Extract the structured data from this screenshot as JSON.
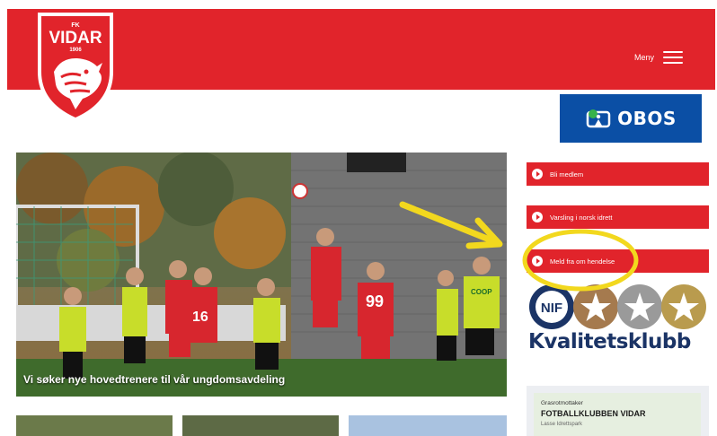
{
  "header": {
    "logo_text": "VIDAR",
    "logo_fk": "FK",
    "logo_year": "1906",
    "menu_label": "Meny",
    "bg_color": "#e1242b"
  },
  "sponsor": {
    "name": "OBOS",
    "bg_color": "#0b4fa5"
  },
  "hero": {
    "caption": "Vi søker nye hovedtrenere til vår ungdomsavdeling",
    "jersey_numbers": [
      "16",
      "99"
    ],
    "shirt_logo": "COOP"
  },
  "sidebar": {
    "buttons": [
      {
        "label": "Bli medlem"
      },
      {
        "label": "Varsling i norsk idrett"
      },
      {
        "label": "Meld fra om hendelse"
      }
    ],
    "kvalitet": {
      "title": "Kvalitetsklubb",
      "badge_text": "NIF"
    },
    "grasrot": {
      "small": "Grasrotmottaker",
      "title": "FOTBALLKLUBBEN VIDAR",
      "sub": "Lasse Idrettspark"
    }
  },
  "annotation": {
    "arrow_color": "#f2d81e",
    "circle_color": "#f2d81e"
  }
}
